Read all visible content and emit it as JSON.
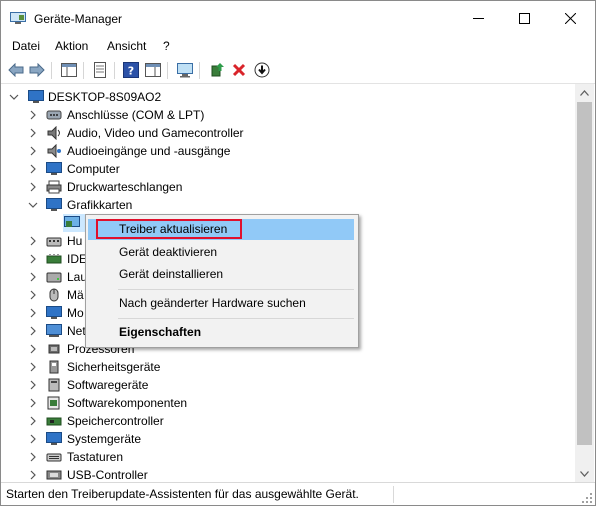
{
  "window": {
    "title": "Geräte-Manager",
    "minimize": "—",
    "maximize": "☐",
    "close": "✕"
  },
  "menu": [
    "Datei",
    "Aktion",
    "Ansicht",
    "?"
  ],
  "tree": {
    "root": "DESKTOP-8S09AO2",
    "items": [
      "Anschlüsse (COM & LPT)",
      "Audio, Video und Gamecontroller",
      "Audioeingänge und -ausgänge",
      "Computer",
      "Druckwarteschlangen",
      "Grafikkarten",
      "",
      "Hu",
      "IDE",
      "Lau",
      "Mä",
      "Mo",
      "Net",
      "Prozessoren",
      "Sicherheitsgeräte",
      "Softwaregeräte",
      "Softwarekomponenten",
      "Speichercontroller",
      "Systemgeräte",
      "Tastaturen",
      "USB-Controller"
    ]
  },
  "context_menu": {
    "items": [
      "Treiber aktualisieren",
      "Gerät deaktivieren",
      "Gerät deinstallieren",
      "Nach geänderter Hardware suchen",
      "Eigenschaften"
    ],
    "highlight_color": "#91c9f7",
    "callout_color": "#e0102c"
  },
  "status": {
    "text": "Starten den Treiberupdate-Assistenten für das ausgewählte Gerät."
  }
}
